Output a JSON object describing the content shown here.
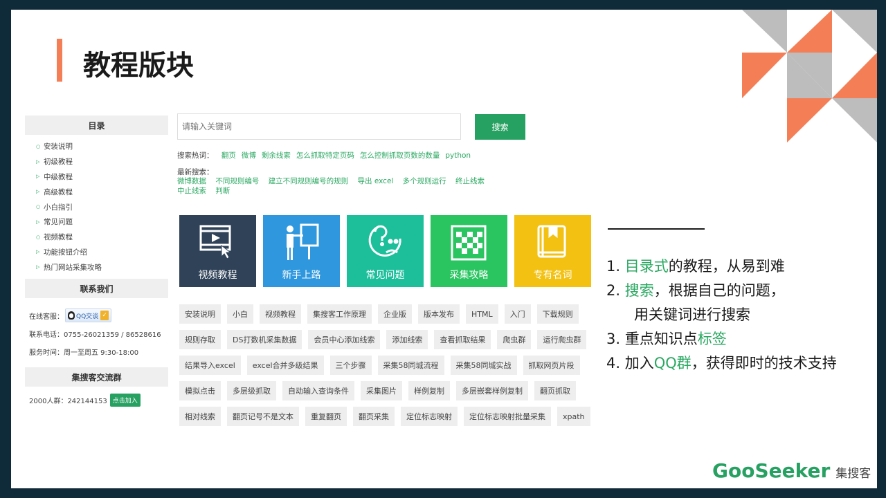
{
  "page_title": "教程版块",
  "colors": {
    "accent": "#f47f57",
    "green": "#27a162",
    "gray": "#bdbdbd"
  },
  "sidebar": {
    "catalog_title": "目录",
    "items": [
      {
        "label": "安装说明",
        "icon": "circle-icon"
      },
      {
        "label": "初级教程",
        "icon": "triangle-right-icon"
      },
      {
        "label": "中级教程",
        "icon": "triangle-right-icon"
      },
      {
        "label": "高级教程",
        "icon": "triangle-right-icon"
      },
      {
        "label": "小白指引",
        "icon": "circle-icon"
      },
      {
        "label": "常见问题",
        "icon": "triangle-right-icon"
      },
      {
        "label": "视频教程",
        "icon": "circle-icon"
      },
      {
        "label": "功能按钮介绍",
        "icon": "triangle-right-icon"
      },
      {
        "label": "热门网站采集攻略",
        "icon": "triangle-right-icon"
      }
    ],
    "contact_title": "联系我们",
    "online_service_label": "在线客服：",
    "qq_chat_label": "QQ交谈",
    "phone": "联系电话：0755-26021359 / 86528616",
    "hours": "服务时间：周一至周五 9:30-18:00",
    "group_title": "集搜客交流群",
    "group_text": "2000人群：242144153",
    "join_label": "点击加入"
  },
  "search": {
    "placeholder": "请输入关键词",
    "button_label": "搜索",
    "hot_label": "搜索热词：",
    "hot_keywords": [
      "翻页",
      "微博",
      "剩余线索",
      "怎么抓取特定页码",
      "怎么控制抓取页数的数量",
      "python"
    ],
    "recent_label": "最新搜索：",
    "recent_keywords": [
      "微博数据",
      "不同规则编号",
      "建立不同规则编号的规则",
      "导出 excel",
      "多个规则运行",
      "终止线索",
      "中止线索",
      "判断"
    ]
  },
  "cards": [
    {
      "label": "视频教程",
      "color": "#2f4258",
      "icon": "video-icon"
    },
    {
      "label": "新手上路",
      "color": "#2e97de",
      "icon": "teacher-icon"
    },
    {
      "label": "常见问题",
      "color": "#1dbf9b",
      "icon": "question-face-icon"
    },
    {
      "label": "采集攻略",
      "color": "#2ac460",
      "icon": "grid-icon"
    },
    {
      "label": "专有名词",
      "color": "#f2c112",
      "icon": "book-icon"
    }
  ],
  "tags": [
    [
      "安装说明",
      "小白",
      "视频教程",
      "集搜客工作原理",
      "企业版",
      "版本发布",
      "HTML",
      "入门",
      "下载规则"
    ],
    [
      "规则存取",
      "DS打数机采集数据",
      "会员中心添加线索",
      "添加线索",
      "查看抓取结果",
      "爬虫群",
      "运行爬虫群"
    ],
    [
      "结果导入excel",
      "excel合并多级结果",
      "三个步骤",
      "采集58同城流程",
      "采集58同城实战",
      "抓取网页片段"
    ],
    [
      "模拟点击",
      "多层级抓取",
      "自动输入查询条件",
      "采集图片",
      "样例复制",
      "多层嵌套样例复制",
      "翻页抓取"
    ],
    [
      "相对线索",
      "翻页记号不是文本",
      "重复翻页",
      "翻页采集",
      "定位标志映射",
      "定位标志映射批量采集",
      "xpath"
    ]
  ],
  "points": {
    "p1_num": "1. ",
    "p1_green": "目录式",
    "p1_rest": "的教程，从易到难",
    "p2_num": "2. ",
    "p2_green": "搜索",
    "p2_rest": "，根据自己的问题，",
    "p2_line2": "用关键词进行搜索",
    "p3_num": "3. ",
    "p3_rest": "重点知识点",
    "p3_green": "标签",
    "p4_num": "4. ",
    "p4_pre": "加入",
    "p4_green": "QQ群",
    "p4_rest": "，获得即时的技术支持"
  },
  "logo": {
    "brand": "GooSeeker",
    "cn": "集搜客"
  }
}
